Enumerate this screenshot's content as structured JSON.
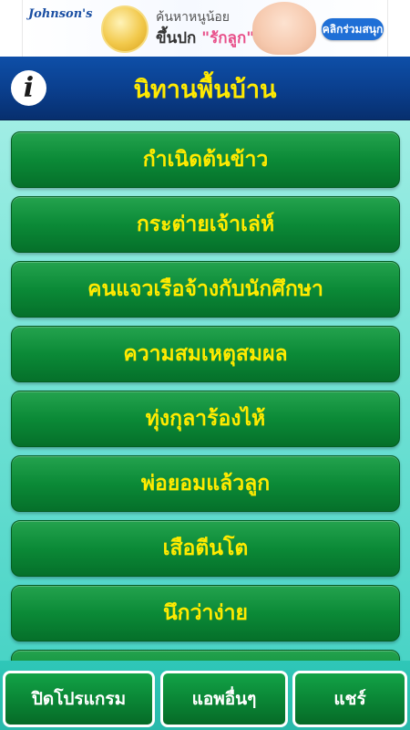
{
  "ad": {
    "brand": "Johnson's",
    "line1": "ค้นหาหนูน้อย",
    "line2_prefix": "ขึ้นปก ",
    "line2_highlight": "\"รักลูก\"",
    "cta": "คลิกร่วมสนุก"
  },
  "header": {
    "title": "นิทานพื้นบ้าน",
    "info_icon": "info-icon",
    "info_symbol": "i"
  },
  "stories": [
    "กำเนิดต้นข้าว",
    "กระต่ายเจ้าเล่ห์",
    "คนแจวเรือจ้างกับนักศึกษา",
    "ความสมเหตุสมผล",
    "ทุ่งกุลาร้องไห้",
    "พ่อยอมแล้วลูก",
    "เสือตีนโต",
    "นึกว่าง่าย",
    ""
  ],
  "bottom": {
    "close_label": "ปิดโปรแกรม",
    "other_apps_label": "แอพอื่นๆ",
    "share_label": "แชร์"
  },
  "colors": {
    "header_bg": "#0a3e8c",
    "title_text": "#ffea00",
    "button_green": "#0b8a37",
    "background_teal": "#7fe6da"
  }
}
